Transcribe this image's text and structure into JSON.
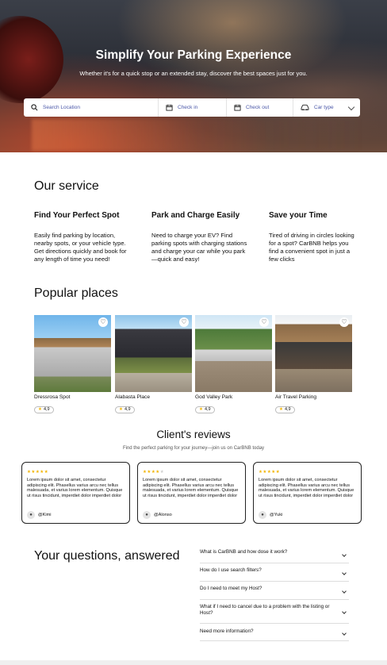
{
  "hero": {
    "title": "Simplify Your Parking Experience",
    "subtitle": "Whether it's for a quick stop or an extended stay, discover the best spaces just for you."
  },
  "search": {
    "location_placeholder": "Search Location",
    "check_in_label": "Check in",
    "check_out_label": "Check out",
    "car_type_label": "Car type"
  },
  "service": {
    "heading": "Our service",
    "items": [
      {
        "title": "Find Your Perfect Spot",
        "text": "Easily find parking by location, nearby spots, or your vehicle type. Get directions quickly and book for any length of time you need!"
      },
      {
        "title": "Park and Charge Easily",
        "text": "Need to charge your EV? Find parking spots with charging stations and charge your car while you park—quick and easy!"
      },
      {
        "title": "Save your Time",
        "text": "Tired of driving in circles looking for a spot? CarBNB helps you find a convenient spot in just a few clicks"
      }
    ]
  },
  "places": {
    "heading": "Popular places",
    "items": [
      {
        "name": "Dressrosa Spot",
        "rating": "4,9"
      },
      {
        "name": "Alabasta Place",
        "rating": "4,9"
      },
      {
        "name": "God Valley Park",
        "rating": "4,9"
      },
      {
        "name": "Air Travel Parking",
        "rating": "4,9"
      }
    ]
  },
  "reviews": {
    "heading": "Client's reviews",
    "subheading": "Find the perfect parking for your journey—join us on CarBNB today",
    "items": [
      {
        "stars": 5,
        "text": "Lorem ipsum dolor sit amet, consectetur adipiscing elit. Phasellus varius arcu nec tellus malesuada, et varius lorem elementum. Quisque ut risus tincidunt, imperdiet dolor imperdiet dolor",
        "user": "@Kimi"
      },
      {
        "stars": 4,
        "text": "Lorem ipsum dolor sit amet, consectetur adipiscing elit. Phasellus varius arcu nec tellus malesuada, et varius lorem elementum. Quisque ut risus tincidunt, imperdiet dolor imperdiet dolor",
        "user": "@Alonso"
      },
      {
        "stars": 5,
        "text": "Lorem ipsum dolor sit amet, consectetur adipiscing elit. Phasellus varius arcu nec tellus malesuada, et varius lorem elementum. Quisque ut risus tincidunt, imperdiet dolor imperdiet dolor",
        "user": "@Yuki"
      }
    ]
  },
  "faq": {
    "heading": "Your questions, answered",
    "items": [
      {
        "q": "What is CarBNB and how dose it work?"
      },
      {
        "q": "How do I use search filters?"
      },
      {
        "q": "Do I need to meet my Host?"
      },
      {
        "q": "What if I need to cancel due to a problem with the listing or Host?"
      },
      {
        "q": "Need more information?"
      }
    ]
  },
  "colors": {
    "accent_text": "#4a57a8",
    "star": "#f2b400"
  }
}
